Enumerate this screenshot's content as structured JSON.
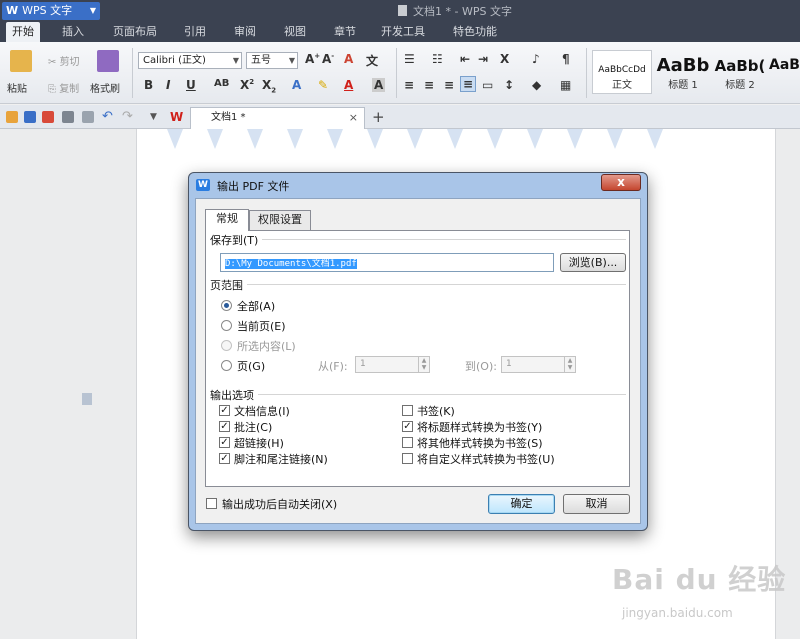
{
  "app": {
    "name": "WPS 文字",
    "window_title": "文档1 * - WPS 文字"
  },
  "menu": [
    "开始",
    "插入",
    "页面布局",
    "引用",
    "审阅",
    "视图",
    "章节",
    "开发工具",
    "特色功能"
  ],
  "ribbon": {
    "paste": "粘贴",
    "cut": "剪切",
    "copy": "复制",
    "format_painter": "格式刷",
    "font_name": "Calibri (正文)",
    "font_size": "五号",
    "styles": [
      {
        "sample": "AaBbCcDd",
        "label": "正文"
      },
      {
        "sample": "AaBb",
        "label": "标题 1"
      },
      {
        "sample": "AaBb(",
        "label": "标题 2"
      },
      {
        "sample": "AaB",
        "label": ""
      }
    ]
  },
  "tabs": {
    "document": "文档1 *"
  },
  "dialog": {
    "title": "输出 PDF 文件",
    "close": "x",
    "tabs": [
      "常规",
      "权限设置"
    ],
    "save_to_label": "保存到(T)",
    "path": "D:\\My Documents\\文档1.pdf",
    "browse": "浏览(B)...",
    "range_label": "页范围",
    "range_options": [
      {
        "label": "全部(A)",
        "checked": true,
        "enabled": true
      },
      {
        "label": "当前页(E)",
        "checked": false,
        "enabled": true
      },
      {
        "label": "所选内容(L)",
        "checked": false,
        "enabled": false
      },
      {
        "label": "页(G)",
        "checked": false,
        "enabled": true
      }
    ],
    "from_label": "从(F):",
    "from_value": "1",
    "to_label": "到(O):",
    "to_value": "1",
    "output_label": "输出选项",
    "output_left": [
      {
        "label": "文档信息(I)",
        "checked": true
      },
      {
        "label": "批注(C)",
        "checked": true
      },
      {
        "label": "超链接(H)",
        "checked": true
      },
      {
        "label": "脚注和尾注链接(N)",
        "checked": true
      }
    ],
    "output_right": [
      {
        "label": "书签(K)",
        "checked": false
      },
      {
        "label": "将标题样式转换为书签(Y)",
        "checked": true
      },
      {
        "label": "将其他样式转换为书签(S)",
        "checked": false
      },
      {
        "label": "将自定义样式转换为书签(U)",
        "checked": false
      }
    ],
    "auto_close": "输出成功后自动关闭(X)",
    "ok": "确定",
    "cancel": "取消"
  },
  "watermark": {
    "logo": "Bai du 经验",
    "url": "jingyan.baidu.com"
  }
}
